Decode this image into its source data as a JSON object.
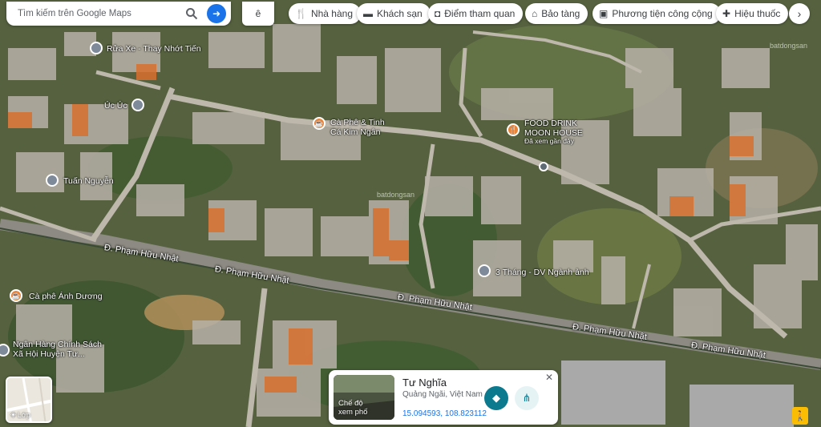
{
  "search": {
    "placeholder": "Tìm kiếm trên Google Maps"
  },
  "language": {
    "label": "ê"
  },
  "chips": [
    {
      "label": "Nhà hàng",
      "icon": "fork-knife-icon"
    },
    {
      "label": "Khách sạn",
      "icon": "bed-icon"
    },
    {
      "label": "Điểm tham quan",
      "icon": "camera-icon"
    },
    {
      "label": "Bảo tàng",
      "icon": "museum-icon"
    },
    {
      "label": "Phương tiện công cộng",
      "icon": "bus-icon"
    },
    {
      "label": "Hiệu thuốc",
      "icon": "pharmacy-icon"
    }
  ],
  "places": [
    {
      "name": "Rửa Xe - Thay Nhớt Tiến",
      "kind": "gray"
    },
    {
      "name": "Úc Úc",
      "kind": "gray"
    },
    {
      "name": "Cà Phê & Tinh\nCá Kim Ngân",
      "kind": "orange"
    },
    {
      "name": "FOOD DRINK\nMOON HOUSE",
      "sub": "Đã xem gần đây",
      "kind": "orange"
    },
    {
      "name": "Tuấn Nguyễn",
      "kind": "gray"
    },
    {
      "name": "3 Tháng - DV Ngành ảnh",
      "kind": "gray"
    },
    {
      "name": "Cà phê Ánh Dương",
      "kind": "orange"
    },
    {
      "name": "Ngân Hàng Chính Sách\nXã Hội Huyện Tư...",
      "kind": "gray"
    }
  ],
  "roads": [
    {
      "name": "Đ. Phạm Hữu Nhật"
    },
    {
      "name": "Đ. Phạm Hữu Nhật"
    },
    {
      "name": "Đ. Phạm Hữu Nhật"
    },
    {
      "name": "Đ. Phạm Hữu Nhật"
    },
    {
      "name": "Đ. Phạm Hữu Nhật"
    }
  ],
  "layers": {
    "label": "Lớp"
  },
  "card": {
    "name": "Tư Nghĩa",
    "address": "Quảng Ngãi, Việt Nam",
    "coords": "15.094593, 108.823112",
    "thumb_label": "Chế độ\nxem phố"
  },
  "watermark": "batdongsan"
}
